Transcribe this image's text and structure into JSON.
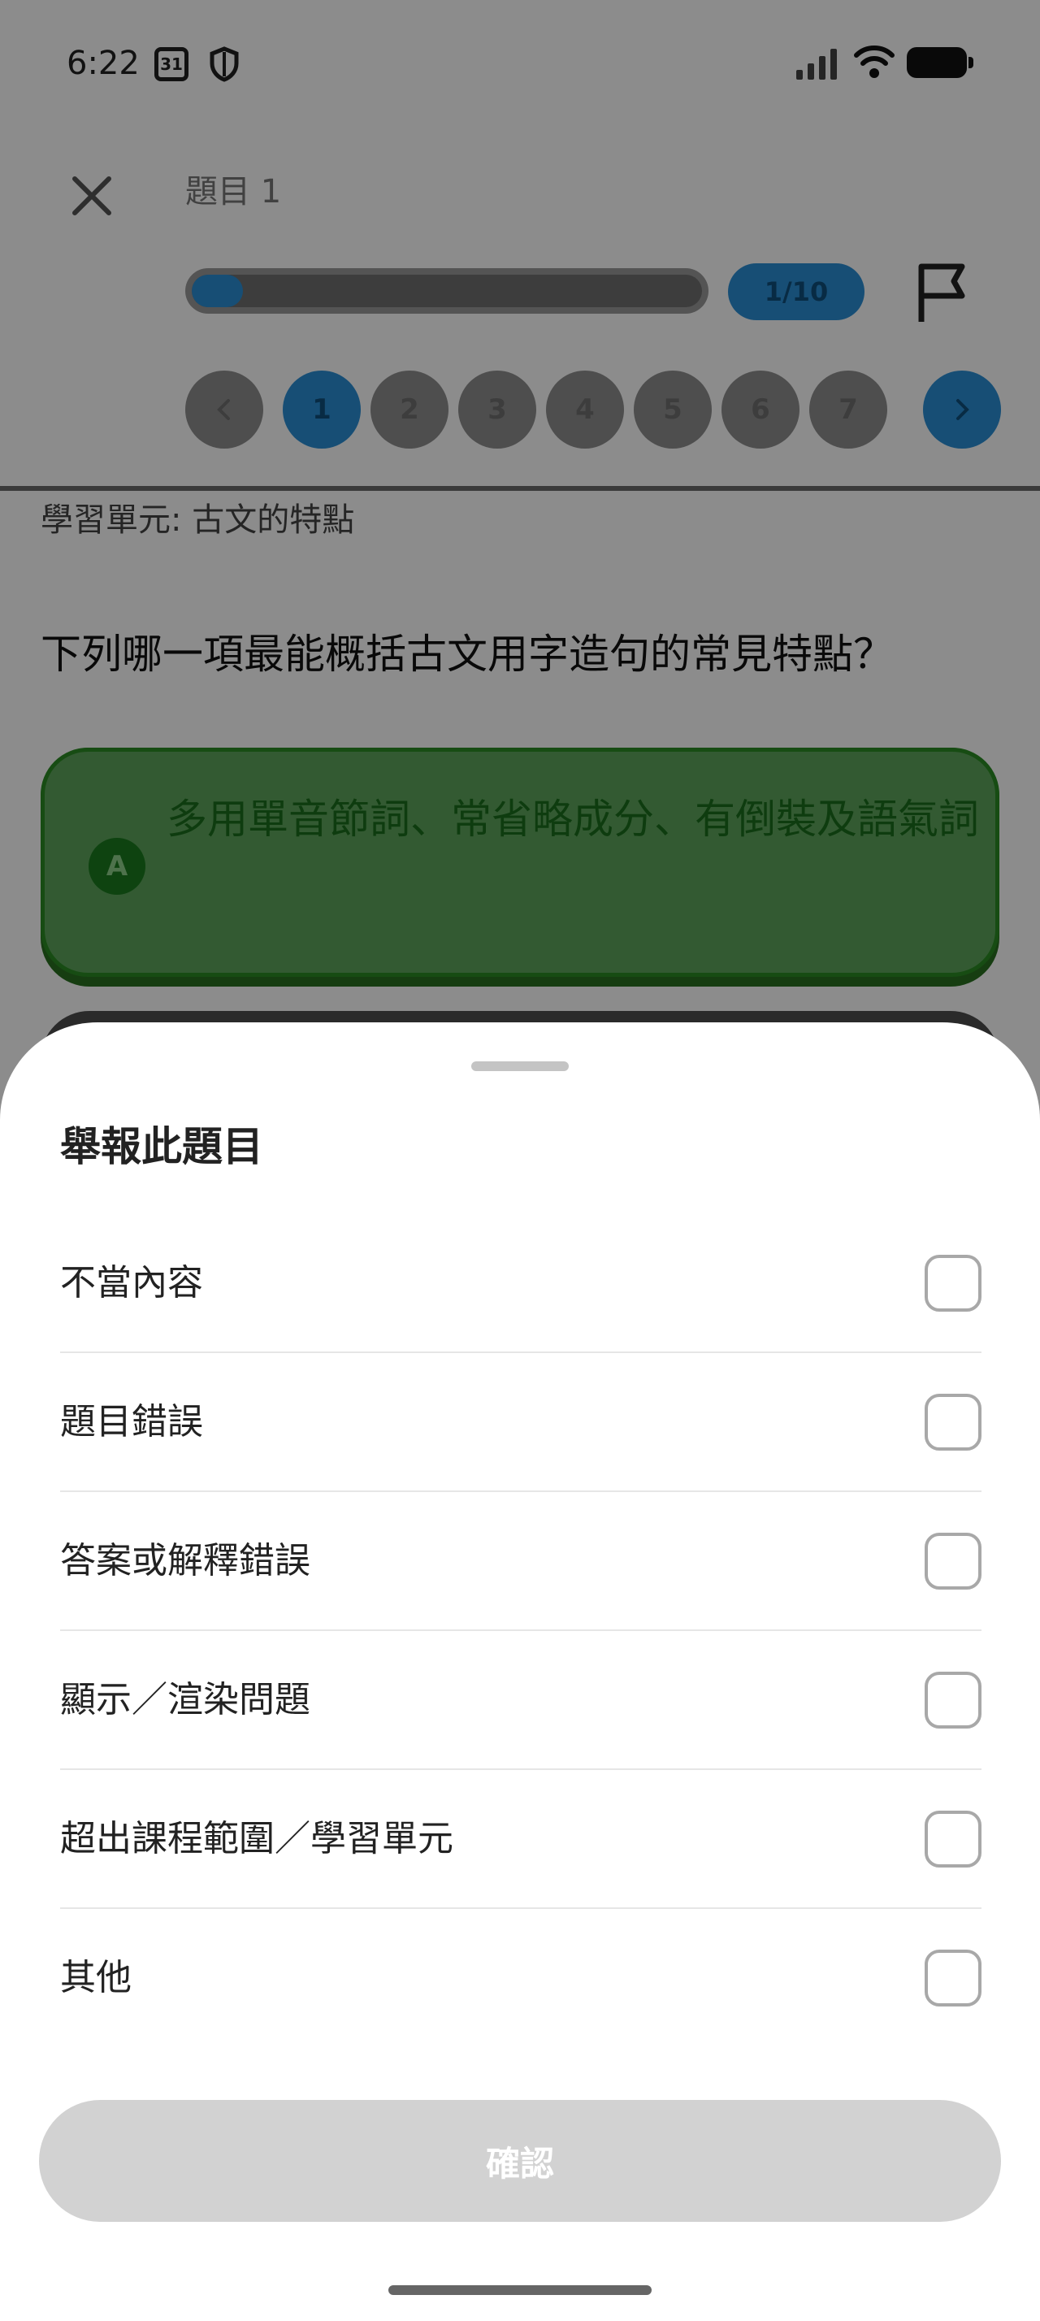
{
  "status_bar": {
    "time": "6:22",
    "calendar_day": "31"
  },
  "quiz": {
    "question_label": "題目 1",
    "progress_text": "1/10",
    "progress_fraction": 0.1,
    "nav_numbers": [
      "1",
      "2",
      "3",
      "4",
      "5",
      "6",
      "7"
    ],
    "unit": "學習單元: 古文的特點",
    "question_text": "下列哪一項最能概括古文用字造句的常見特點？",
    "option_a_letter": "A",
    "option_a_text": "多用單音節詞、常省略成分、有倒裝及語氣詞"
  },
  "report_sheet": {
    "title": "舉報此題目",
    "items": [
      {
        "label": "不當內容"
      },
      {
        "label": "題目錯誤"
      },
      {
        "label": "答案或解釋錯誤"
      },
      {
        "label": "顯示／渲染問題"
      },
      {
        "label": "超出課程範圍／學習單元"
      },
      {
        "label": "其他"
      }
    ],
    "confirm_label": "確認"
  },
  "colors": {
    "accent": "#2b8fd6",
    "correct_green": "#5da55b",
    "disabled_button": "#d2d2d2"
  }
}
